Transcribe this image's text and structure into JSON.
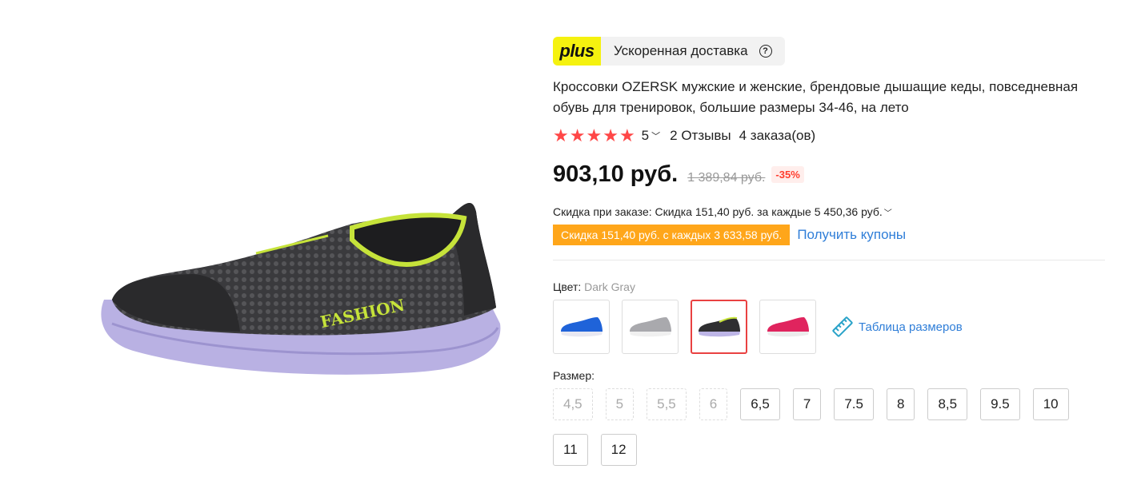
{
  "plus": {
    "logo": "plus",
    "delivery": "Ускоренная доставка",
    "help_icon": "question-circle-icon"
  },
  "product": {
    "title": "Кроссовки OZERSK мужские и женские, брендовые дышащие кеды, повседневная обувь для тренировок, большие размеры 34-46, на лето",
    "rating": "5",
    "reviews": "2 Отзывы",
    "orders": "4 заказа(ов)",
    "price": "903,10 руб.",
    "old_price": "1 389,84 руб.",
    "discount": "-35%",
    "order_discount": "Скидка при заказе: Скидка 151,40 руб. за каждые 5 450,36 руб.",
    "coupon_tag": "Скидка 151,40 руб. с каждых 3 633,58 руб.",
    "coupon_link": "Получить купоны",
    "shoe_print": "FASHION"
  },
  "color": {
    "label": "Цвет: ",
    "value": "Dark Gray",
    "options": [
      "Blue",
      "Gray",
      "Dark Gray",
      "Rose"
    ],
    "selected_index": 2,
    "size_chart": "Таблица размеров"
  },
  "size": {
    "label": "Размер:",
    "options": [
      {
        "label": "4,5",
        "available": false
      },
      {
        "label": "5",
        "available": false
      },
      {
        "label": "5,5",
        "available": false
      },
      {
        "label": "6",
        "available": false
      },
      {
        "label": "6,5",
        "available": true
      },
      {
        "label": "7",
        "available": true
      },
      {
        "label": "7.5",
        "available": true
      },
      {
        "label": "8",
        "available": true
      },
      {
        "label": "8,5",
        "available": true
      },
      {
        "label": "9.5",
        "available": true
      },
      {
        "label": "10",
        "available": true
      },
      {
        "label": "11",
        "available": true
      },
      {
        "label": "12",
        "available": true
      }
    ]
  },
  "colors": {
    "star": "#ff4747",
    "link": "#2f7ed8",
    "coupon": "#ffa61a",
    "selected_border": "#e94141",
    "plus_yellow": "#f5f20f"
  }
}
